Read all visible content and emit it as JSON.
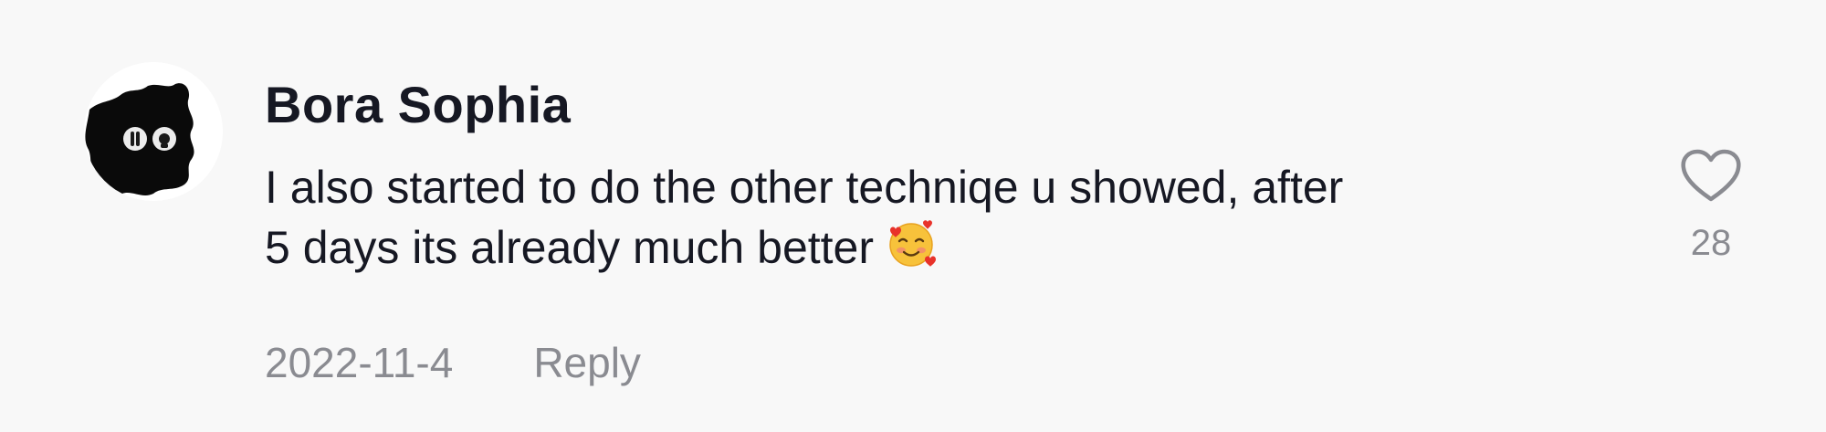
{
  "comment": {
    "username": "Bora Sophia",
    "text_line1": "I also started to do the other techniqe u showed, after",
    "text_line2": "5 days its already much better",
    "emoji_icon": "smiling-face-with-hearts-icon",
    "date": "2022-11-4",
    "reply_label": "Reply",
    "like_icon": "heart-outline-icon",
    "like_count": "28"
  },
  "colors": {
    "background": "#f8f8f8",
    "text_primary": "#161823",
    "text_secondary": "#8a8b91"
  }
}
